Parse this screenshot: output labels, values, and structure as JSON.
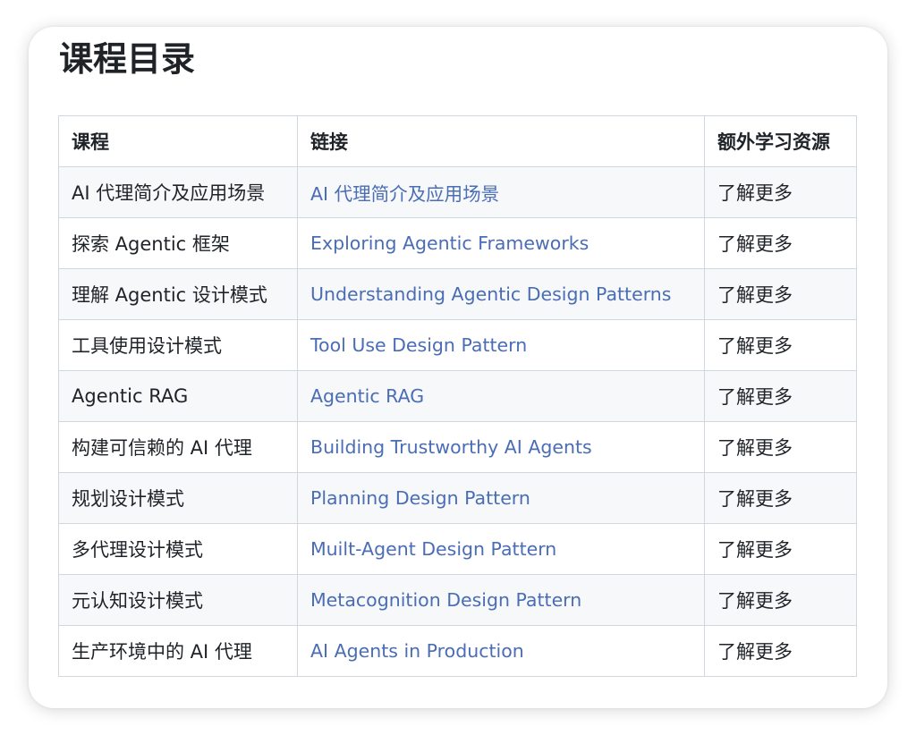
{
  "page": {
    "title": "课程目录"
  },
  "table": {
    "headers": [
      "课程",
      "链接",
      "额外学习资源"
    ],
    "rows": [
      {
        "course": "AI 代理简介及应用场景",
        "link": "AI 代理简介及应用场景",
        "extra": "了解更多"
      },
      {
        "course": "探索 Agentic 框架",
        "link": "Exploring Agentic Frameworks",
        "extra": "了解更多"
      },
      {
        "course": "理解 Agentic 设计模式",
        "link": "Understanding Agentic Design Patterns",
        "extra": "了解更多"
      },
      {
        "course": "工具使用设计模式",
        "link": "Tool Use Design Pattern",
        "extra": "了解更多"
      },
      {
        "course": "Agentic RAG",
        "link": "Agentic RAG",
        "extra": "了解更多"
      },
      {
        "course": "构建可信赖的 AI 代理",
        "link": "Building Trustworthy AI Agents",
        "extra": "了解更多"
      },
      {
        "course": "规划设计模式",
        "link": "Planning Design Pattern",
        "extra": "了解更多"
      },
      {
        "course": "多代理设计模式",
        "link": "Muilt-Agent Design Pattern",
        "extra": "了解更多"
      },
      {
        "course": "元认知设计模式",
        "link": "Metacognition Design Pattern",
        "extra": "了解更多"
      },
      {
        "course": "生产环境中的 AI 代理",
        "link": "AI Agents in Production",
        "extra": "了解更多"
      }
    ]
  },
  "colors": {
    "link": "#4a6db5",
    "text": "#1f2328",
    "border": "#d0d7de",
    "stripe": "#f6f8fa"
  }
}
